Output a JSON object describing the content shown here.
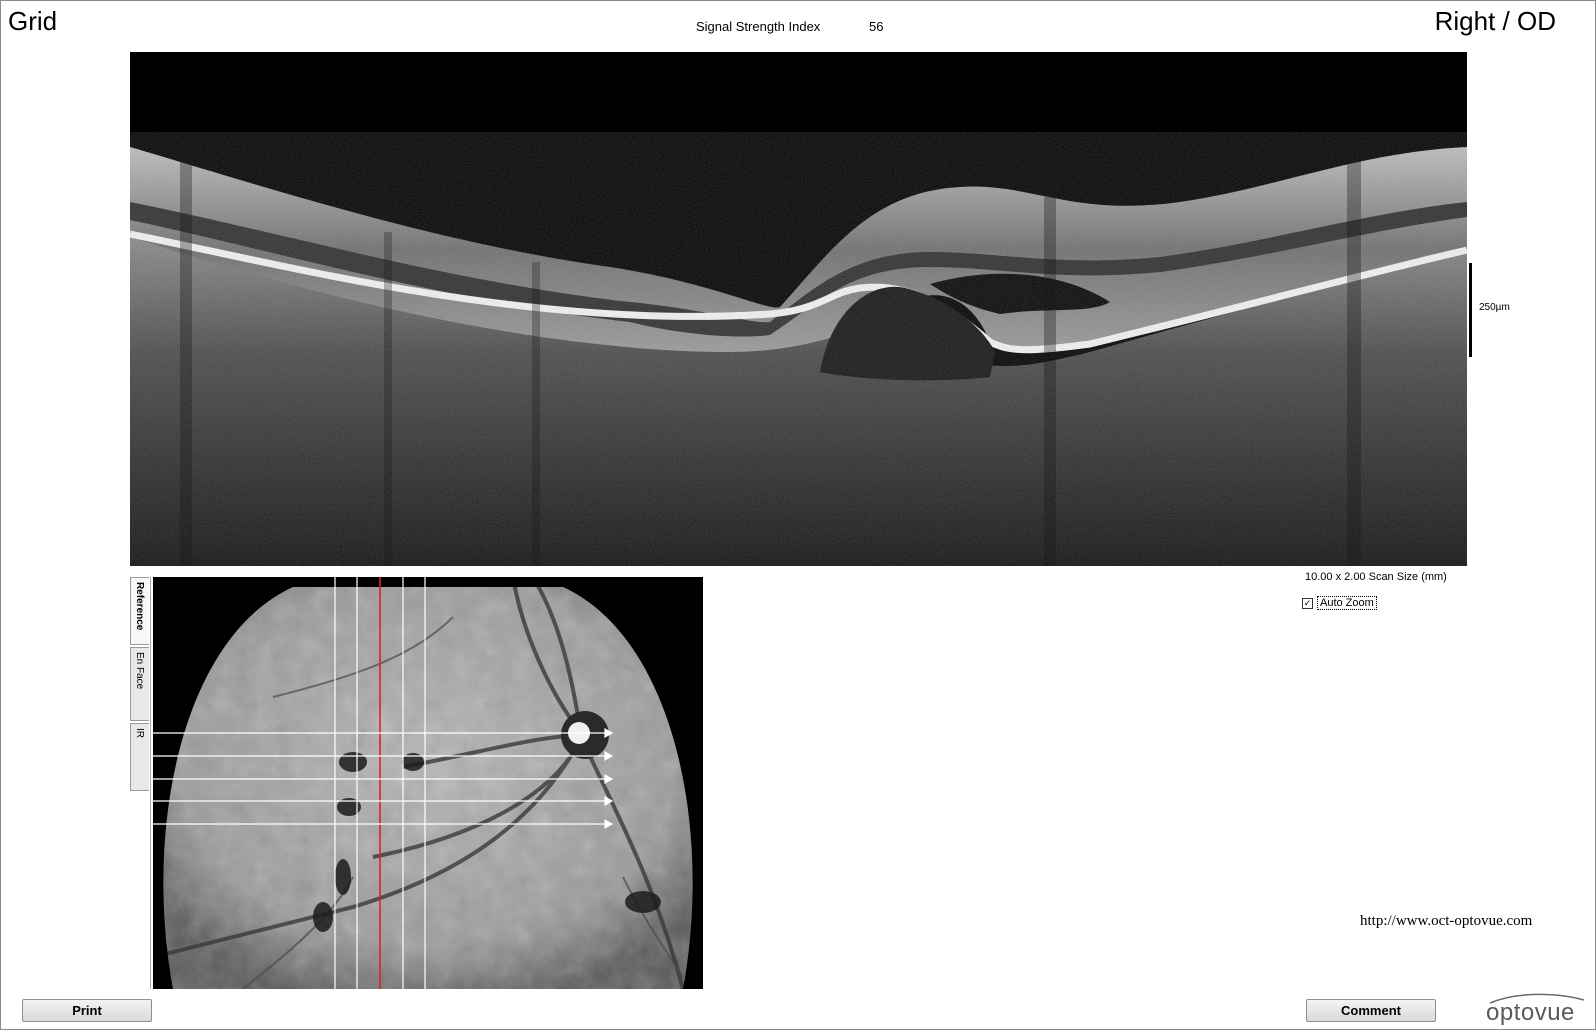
{
  "header": {
    "scan_type": "Grid",
    "eye": "Right / OD",
    "signal_strength_label": "Signal Strength Index",
    "signal_strength_value": "56"
  },
  "bscan": {
    "scale_label": "250µm"
  },
  "scan_info": {
    "scan_size": "10.00 x 2.00 Scan Size (mm)",
    "auto_zoom_label": "Auto Zoom",
    "auto_zoom_checked": "✓"
  },
  "tabs": [
    {
      "label": "Reference",
      "active": true
    },
    {
      "label": "En Face",
      "active": false
    },
    {
      "label": "IR",
      "active": false
    }
  ],
  "footer": {
    "url": "http://www.oct-optovue.com",
    "print_label": "Print",
    "comment_label": "Comment",
    "logo_text": "optovue"
  },
  "colors": {
    "scan_line_active": "#e02020",
    "scan_line": "#ffffff",
    "accent": "#1a9fd6"
  }
}
